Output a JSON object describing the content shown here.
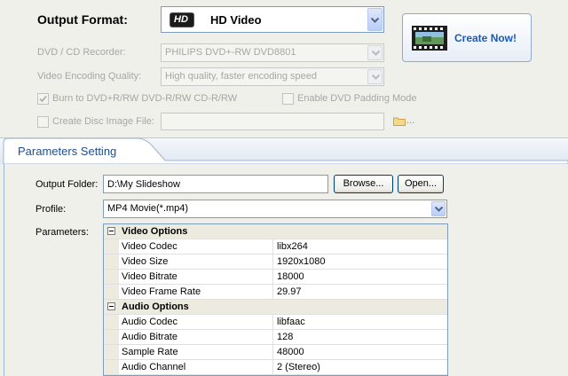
{
  "output_format": {
    "label": "Output Format:",
    "hd_badge": "HD",
    "selected": "HD Video",
    "create_button": "Create Now!"
  },
  "disc": {
    "recorder_label": "DVD / CD Recorder:",
    "recorder_value": "PHILIPS DVD+-RW DVD8801",
    "quality_label": "Video Encoding Quality:",
    "quality_value": "High quality, faster encoding speed",
    "burn_label": "Burn to DVD+R/RW DVD-R/RW  CD-R/RW",
    "burn_checked": true,
    "padding_label": "Enable DVD Padding Mode",
    "padding_checked": false,
    "image_label": "Create Disc Image File:",
    "image_checked": false,
    "image_value": "",
    "image_browse": "..."
  },
  "parameters_tab": "Parameters Setting",
  "output_folder": {
    "label": "Output Folder:",
    "value": "D:\\My Slideshow",
    "browse": "Browse...",
    "open": "Open..."
  },
  "profile": {
    "label": "Profile:",
    "value": "MP4 Movie(*.mp4)"
  },
  "parameters": {
    "label": "Parameters:",
    "video_header": "Video Options",
    "video_rows": [
      {
        "name": "Video Codec",
        "value": "libx264"
      },
      {
        "name": "Video Size",
        "value": "1920x1080"
      },
      {
        "name": "Video Bitrate",
        "value": "18000"
      },
      {
        "name": "Video Frame Rate",
        "value": "29.97"
      }
    ],
    "audio_header": "Audio Options",
    "audio_rows": [
      {
        "name": "Audio Codec",
        "value": "libfaac"
      },
      {
        "name": "Audio Bitrate",
        "value": "128"
      },
      {
        "name": "Sample Rate",
        "value": "48000"
      },
      {
        "name": "Audio Channel",
        "value": "2 (Stereo)"
      }
    ]
  },
  "colors": {
    "accent_blue": "#1c5ab4",
    "tab_text": "#1f4f8f",
    "disabled_text": "#a6a6a6"
  }
}
